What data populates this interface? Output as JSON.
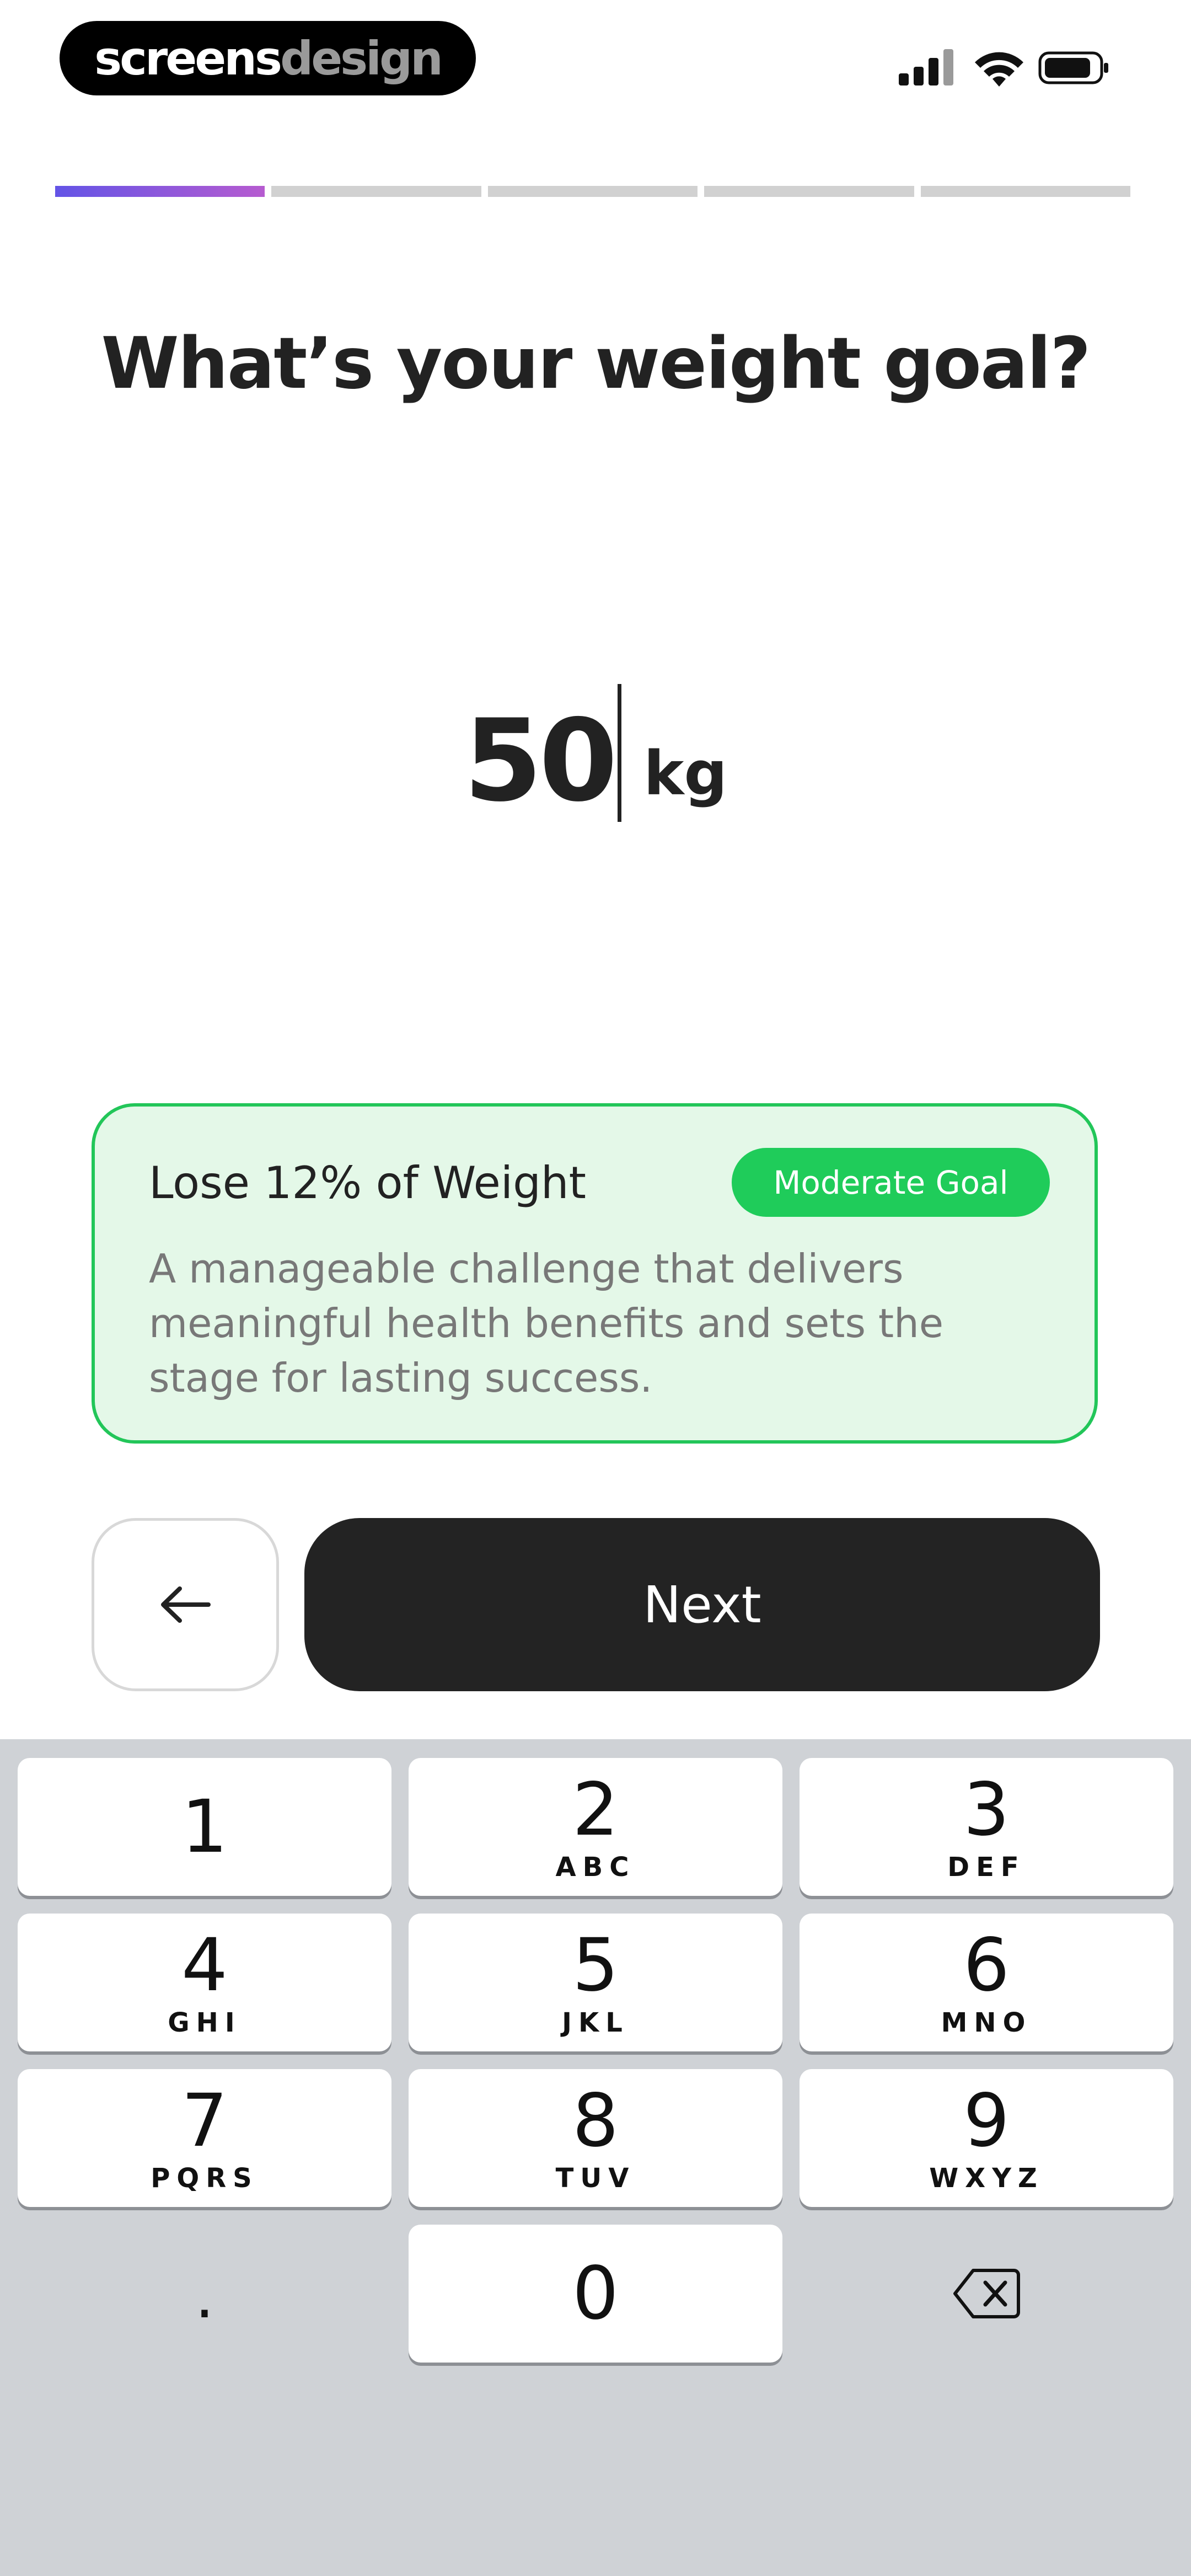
{
  "status_bar": {
    "logo_part1": "screens",
    "logo_part2": "design",
    "icons": [
      "signal-icon",
      "wifi-icon",
      "battery-icon"
    ]
  },
  "progress": {
    "total_steps": 5,
    "current_step": 1
  },
  "question": "What’s your weight goal?",
  "weight": {
    "value": "50",
    "unit": "kg"
  },
  "goal_card": {
    "title": "Lose 12% of Weight",
    "badge": "Moderate Goal",
    "description": "A manageable challenge that delivers meaningful health benefits and sets the stage for lasting success."
  },
  "buttons": {
    "back_icon": "arrow-left-icon",
    "next_label": "Next"
  },
  "keyboard": {
    "keys": [
      {
        "digit": "1",
        "letters": ""
      },
      {
        "digit": "2",
        "letters": "ABC"
      },
      {
        "digit": "3",
        "letters": "DEF"
      },
      {
        "digit": "4",
        "letters": "GHI"
      },
      {
        "digit": "5",
        "letters": "JKL"
      },
      {
        "digit": "6",
        "letters": "MNO"
      },
      {
        "digit": "7",
        "letters": "PQRS"
      },
      {
        "digit": "8",
        "letters": "TUV"
      },
      {
        "digit": "9",
        "letters": "WXYZ"
      }
    ],
    "decimal": ".",
    "zero": "0",
    "delete_icon": "backspace-icon"
  },
  "colors": {
    "progress_active_start": "#6354e6",
    "progress_active_end": "#b65bd0",
    "card_border": "#22c659",
    "card_bg": "#e4f8e8",
    "badge_bg": "#1fcc5a",
    "next_button_bg": "#232323",
    "keyboard_bg": "#cfd2d6"
  }
}
